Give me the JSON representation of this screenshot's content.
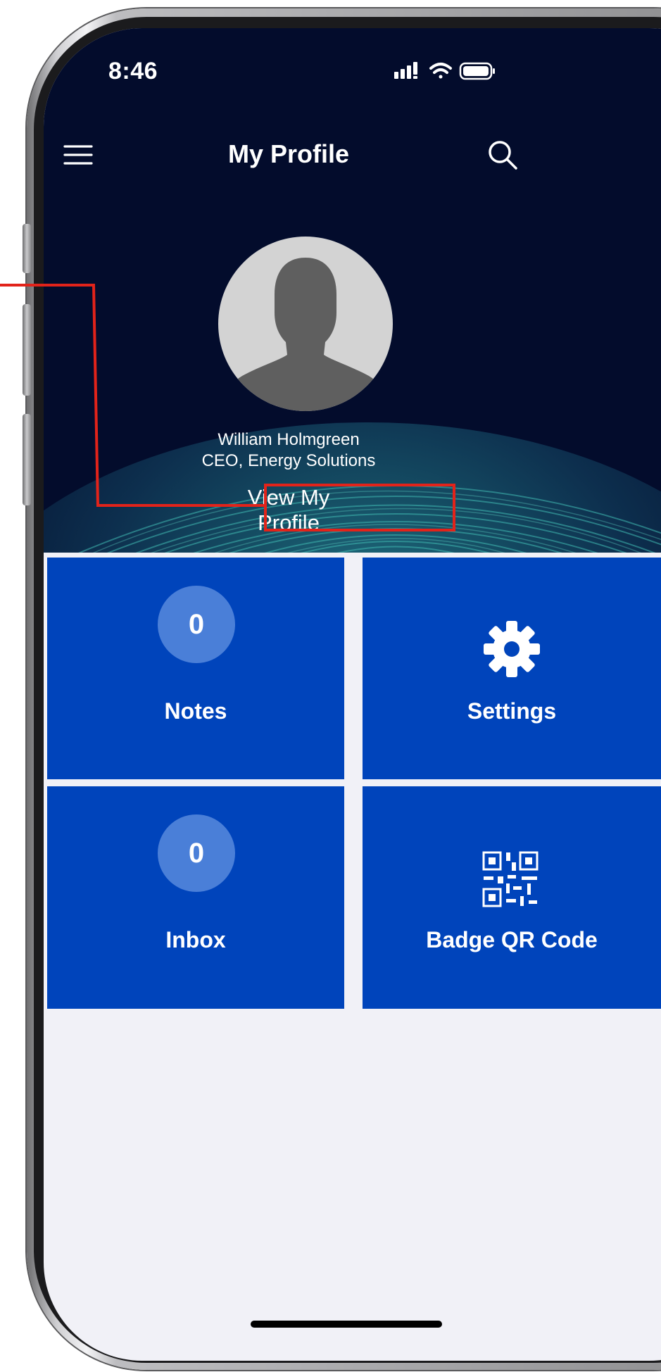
{
  "status_bar": {
    "time": "8:46",
    "icons": [
      "cellular-signal-icon",
      "wifi-icon",
      "battery-icon"
    ]
  },
  "nav_bar": {
    "title": "My Profile",
    "menu_icon": "hamburger-menu-icon",
    "search_icon": "search-icon"
  },
  "profile": {
    "avatar_icon": "person-silhouette-icon",
    "name": "William Holmgreen",
    "title": "CEO, Energy Solutions",
    "view_profile_label": "View My Profile"
  },
  "tiles": [
    {
      "label": "Notes",
      "count": "0"
    },
    {
      "label": "Settings",
      "icon": "gear-icon"
    },
    {
      "label": "Inbox",
      "count": "0"
    },
    {
      "label": "Badge QR Code",
      "icon": "qr-code-icon"
    }
  ],
  "colors": {
    "hero_background": "#030c2c",
    "tile_background": "#0044bb",
    "count_badge": "#4a7fd8",
    "screen_background": "#f1f1f7",
    "annotation": "#e2231a"
  }
}
